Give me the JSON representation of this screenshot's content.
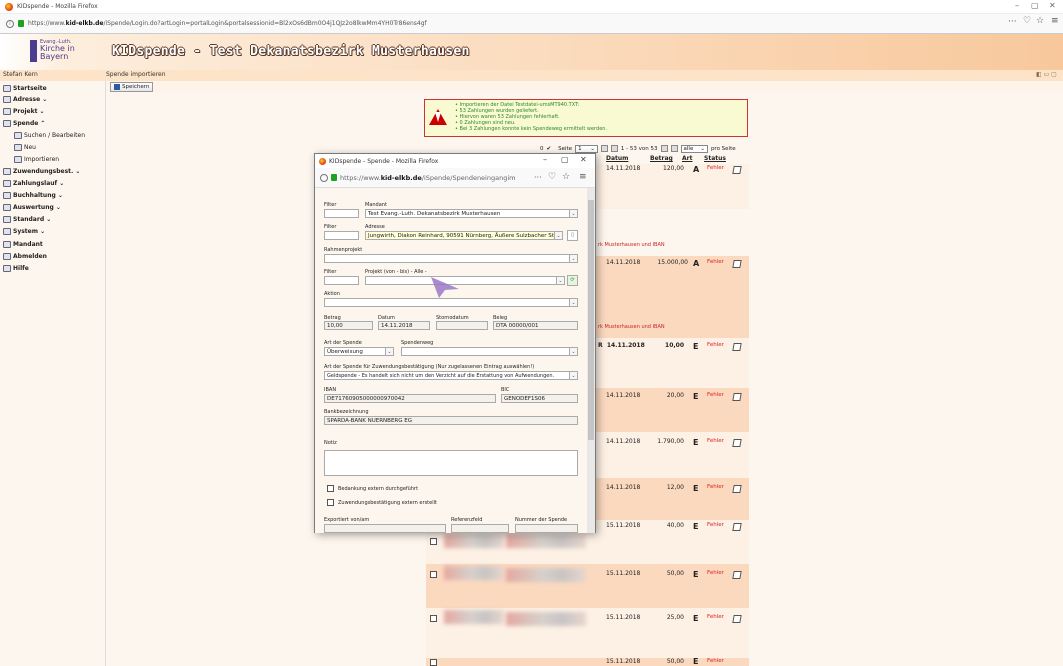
{
  "browser": {
    "title": "KIDspende - Mozilla Firefox",
    "url_prefix": "https://www.",
    "url_domain": "kid-elkb.de",
    "url_rest": "/iSpende/Login.do?artLogin=portalLogin&portalsessionid=Bl2xOs6dBm0O4j1QJz2o8lkwMm4YH0Tr86ens4gf"
  },
  "header": {
    "logo_line1": "Evang.-Luth.",
    "logo_line2": "Kirche in",
    "logo_line3": "Bayern",
    "title": "KIDspende - Test Dekanatsbezirk Musterhausen"
  },
  "user": {
    "name": "Stefan Kern"
  },
  "section": {
    "title": "Spende importieren",
    "save_label": "Speichern"
  },
  "sidebar": {
    "items": [
      {
        "label": "Startseite"
      },
      {
        "label": "Adresse ⌄"
      },
      {
        "label": "Projekt ⌄"
      },
      {
        "label": "Spende ⌃"
      },
      {
        "label": "Suchen / Bearbeiten"
      },
      {
        "label": "Neu"
      },
      {
        "label": "Importieren"
      },
      {
        "label": "Zuwendungsbest. ⌄"
      },
      {
        "label": "Zahlungslauf ⌄"
      },
      {
        "label": "Buchhaltung ⌄"
      },
      {
        "label": "Auswertung ⌄"
      },
      {
        "label": "Standard ⌄"
      },
      {
        "label": "System ⌄"
      },
      {
        "label": "Mandant"
      },
      {
        "label": "Abmelden"
      },
      {
        "label": "Hilfe"
      }
    ]
  },
  "warnings": [
    "Importieren der Datei Testdatei-umsMT940.TXT:",
    "53 Zahlungen wurden geliefert.",
    "Hiervon waren 53 Zahlungen fehlerhaft.",
    "0 Zahlungen sind neu.",
    "Bei 3 Zahlungen konnte kein Spendeweg ermittelt werden."
  ],
  "pager": {
    "count": "0",
    "check": "✔",
    "seite_label": "Seite",
    "page": "1",
    "range": "1 - 53 von 53",
    "perpage": "alle",
    "perpage_label": "pro Seite"
  },
  "table": {
    "headers": {
      "datum": "Datum",
      "betrag": "Betrag",
      "art": "Art",
      "status": "Status"
    },
    "rows": [
      {
        "datum": "14.11.2018",
        "betrag": "120,00",
        "art": "A",
        "status": "Fehler",
        "bold": false
      },
      {
        "datum": "14.11.2018",
        "betrag": "15.000,00",
        "art": "A",
        "status": "Fehler",
        "bold": false
      },
      {
        "datum": "14.11.2018",
        "betrag": "10,00",
        "art": "E",
        "status": "Fehler",
        "bold": true
      },
      {
        "datum": "14.11.2018",
        "betrag": "20,00",
        "art": "E",
        "status": "Fehler",
        "bold": false
      },
      {
        "datum": "14.11.2018",
        "betrag": "1.790,00",
        "art": "E",
        "status": "Fehler",
        "bold": false
      },
      {
        "datum": "14.11.2018",
        "betrag": "12,00",
        "art": "E",
        "status": "Fehler",
        "bold": false
      },
      {
        "datum": "15.11.2018",
        "betrag": "40,00",
        "art": "E",
        "status": "Fehler",
        "bold": false
      },
      {
        "datum": "15.11.2018",
        "betrag": "50,00",
        "art": "E",
        "status": "Fehler",
        "bold": false
      },
      {
        "datum": "15.11.2018",
        "betrag": "25,00",
        "art": "E",
        "status": "Fehler",
        "bold": false
      },
      {
        "datum": "15.11.2018",
        "betrag": "50,00",
        "art": "E",
        "status": "Fehler",
        "bold": false
      }
    ],
    "note_iban": "rk Musterhausen und IBAN",
    "note_r": "R"
  },
  "popup": {
    "title": "KIDspende - Spende - Mozilla Firefox",
    "url_prefix": "https://www.",
    "url_domain": "kid-elkb.de",
    "url_rest": "/iSpende/Spendeneingangim",
    "form": {
      "filter_label": "Filter",
      "mandant_label": "Mandant",
      "mandant_value": "Test Evang.-Luth. Dekanatsbezirk Musterhausen",
      "adresse_label": "Adresse",
      "adresse_value": "Jungwirth, Diakon Reinhard, 90591 Nürnberg, Äußere Sulzbacher Str",
      "rahmenprojekt_label": "Rahmenprojekt",
      "projekt_label": "Projekt (von - bis) - Alle -",
      "aktion_label": "Aktion",
      "betrag_label": "Betrag",
      "betrag_value": "10,00",
      "datum_label": "Datum",
      "datum_value": "14.11.2018",
      "stornodatum_label": "Stornodatum",
      "beleg_label": "Beleg",
      "beleg_value": "DTA 00000/001",
      "art_label": "Art der Spende",
      "art_value": "Überweisung",
      "spendenweg_label": "Spendenweg",
      "zuw_label": "Art der Spende für Zuwendungsbestätigung (Nur zugelassenen Eintrag auswählen!)",
      "zuw_value": "Geldspende - Es handelt sich nicht um den Verzicht auf die Erstattung von Aufwendungen.",
      "iban_label": "IBAN",
      "iban_value": "DE71760905000000970042",
      "bic_label": "BIC",
      "bic_value": "GENODEF1S06",
      "bank_label": "Bankbezeichnung",
      "bank_value": "SPARDA-BANK NUERNBERG EG",
      "notiz_label": "Notiz",
      "chk1_label": "Bedankung extern durchgeführt",
      "chk2_label": "Zuwendungsbestätigung extern erstellt",
      "exportiert_label": "Exportiert von/am",
      "referenz_label": "Referenzfeld",
      "nummer_label": "Nummer der Spende"
    }
  },
  "colors": {
    "accent": "#4a3d8f",
    "error": "#dd2222",
    "header_gradient_end": "#f8c89c"
  }
}
